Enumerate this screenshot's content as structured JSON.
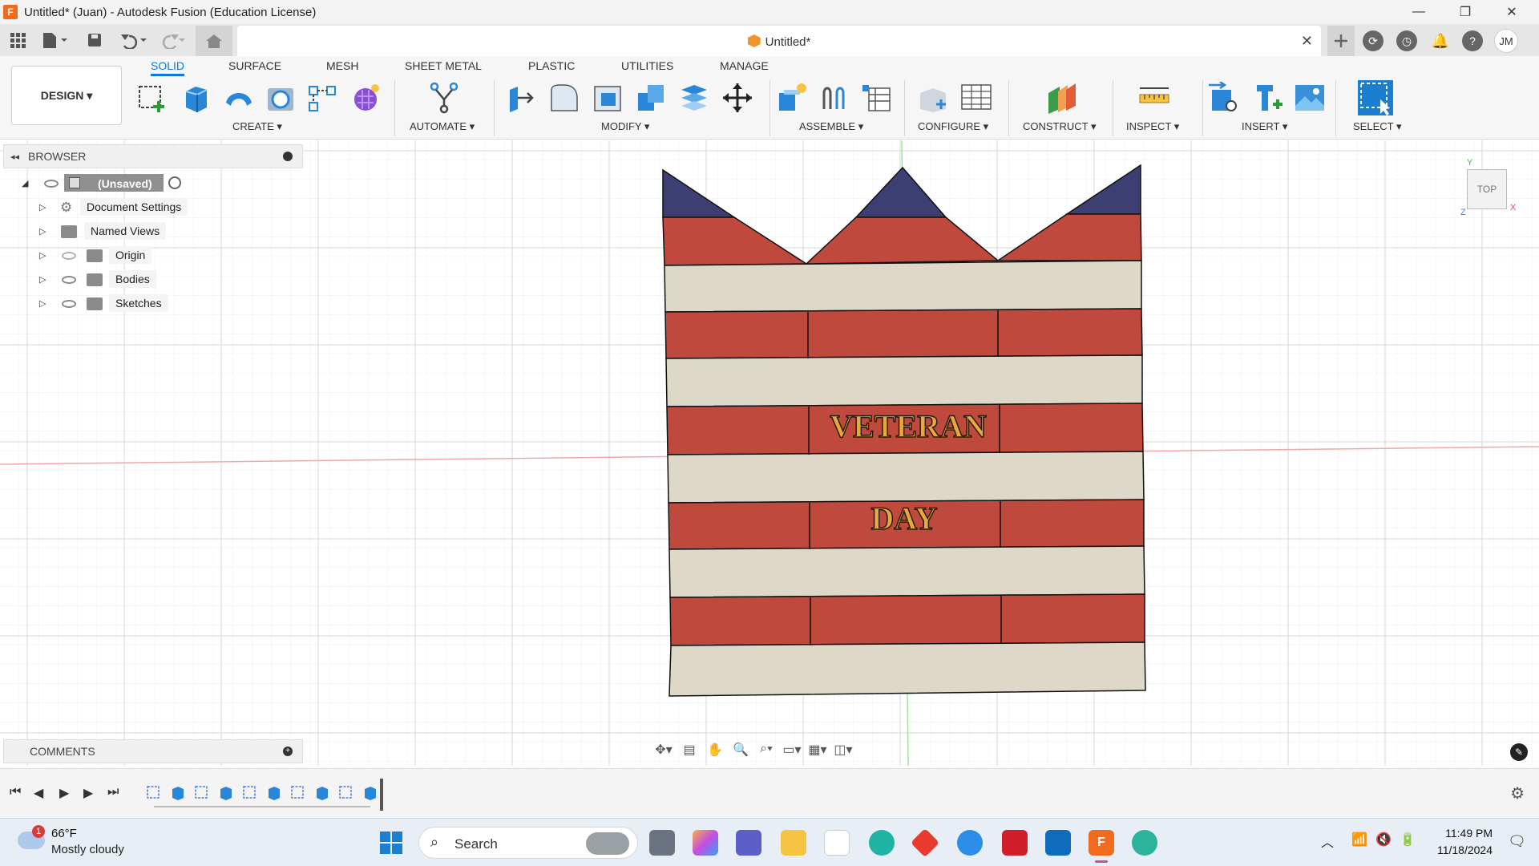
{
  "window": {
    "title": "Untitled* (Juan) - Autodesk Fusion (Education License)",
    "app_logo": "F",
    "minimize": "—",
    "maximize": "❐",
    "close": "✕"
  },
  "quick_access": {
    "doc_tab_title": "Untitled*",
    "doc_tab_close": "✕",
    "user_initials": "JM"
  },
  "ribbon": {
    "design_label": "DESIGN ▾",
    "tabs": [
      "SOLID",
      "SURFACE",
      "MESH",
      "SHEET METAL",
      "PLASTIC",
      "UTILITIES",
      "MANAGE"
    ],
    "groups": {
      "create": "CREATE ▾",
      "automate": "AUTOMATE ▾",
      "modify": "MODIFY ▾",
      "assemble": "ASSEMBLE ▾",
      "configure": "CONFIGURE ▾",
      "construct": "CONSTRUCT ▾",
      "inspect": "INSPECT ▾",
      "insert": "INSERT ▾",
      "select": "SELECT ▾"
    }
  },
  "browser": {
    "title": "BROWSER",
    "root": "(Unsaved)",
    "items": [
      "Document Settings",
      "Named Views",
      "Origin",
      "Bodies",
      "Sketches"
    ]
  },
  "comments": {
    "label": "COMMENTS"
  },
  "canvas": {
    "viewcube_label": "TOP",
    "axis_x": "X",
    "axis_y": "Y",
    "axis_z": "Z",
    "text_line1": "VETERAN",
    "text_line2": "DAY",
    "colors": {
      "navy": "#3d3f72",
      "red": "#c0493e",
      "cream": "#ddd8c7",
      "text_gold": "#e6a93a"
    }
  },
  "taskbar": {
    "weather_badge": "1",
    "weather_temp": "66°F",
    "weather_desc": "Mostly cloudy",
    "search_label": "Search",
    "clock_time": "11:49 PM",
    "clock_date": "11/18/2024"
  }
}
